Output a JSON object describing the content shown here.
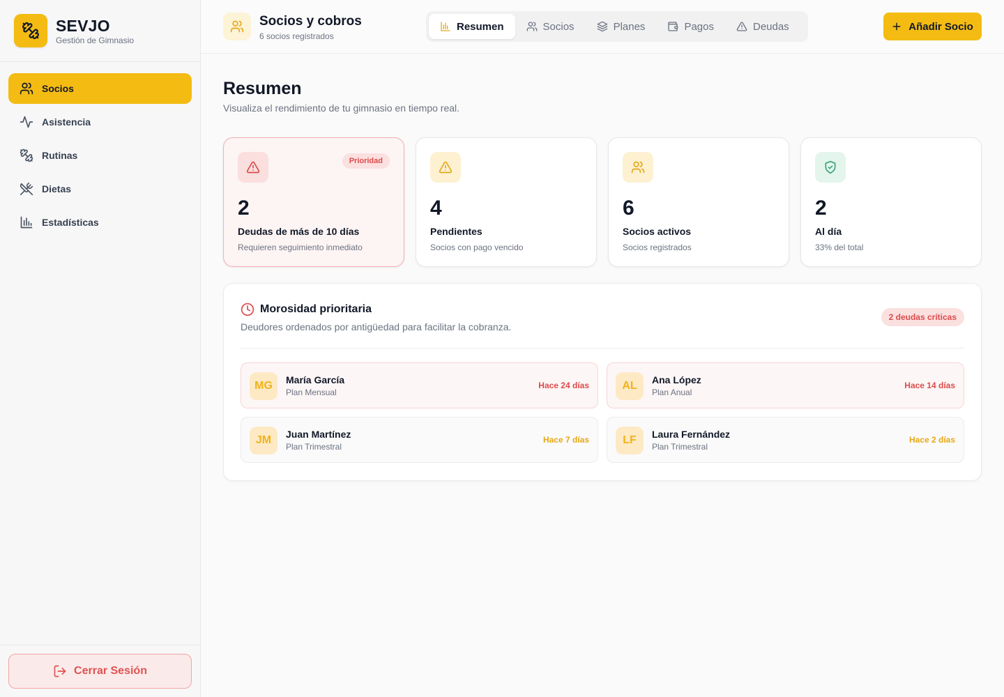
{
  "colors": {
    "accent": "#f4bb13",
    "danger": "#dc4b4b",
    "warning": "#e6a817",
    "success": "#3aa57a"
  },
  "brand": {
    "name": "SEVJO",
    "subtitle": "Gestión de Gimnasio",
    "icon": "dumbbell-icon"
  },
  "sidebar": {
    "items": [
      {
        "label": "Socios",
        "icon": "users-icon",
        "active": true
      },
      {
        "label": "Asistencia",
        "icon": "activity-icon",
        "active": false
      },
      {
        "label": "Rutinas",
        "icon": "dumbbell-icon",
        "active": false
      },
      {
        "label": "Dietas",
        "icon": "utensils-crossed-icon",
        "active": false
      },
      {
        "label": "Estadísticas",
        "icon": "bar-chart-icon",
        "active": false
      }
    ],
    "logout_label": "Cerrar Sesión"
  },
  "header": {
    "title": "Socios y cobros",
    "subtitle": "6 socios registrados",
    "tabs": [
      {
        "label": "Resumen",
        "icon": "chart-icon",
        "active": true
      },
      {
        "label": "Socios",
        "icon": "users-icon",
        "active": false
      },
      {
        "label": "Planes",
        "icon": "layers-icon",
        "active": false
      },
      {
        "label": "Pagos",
        "icon": "wallet-icon",
        "active": false
      },
      {
        "label": "Deudas",
        "icon": "alert-triangle-icon",
        "active": false
      }
    ],
    "add_button_label": "Añadir Socio"
  },
  "main": {
    "title": "Resumen",
    "subtitle": "Visualiza el rendimiento de tu gimnasio en tiempo real."
  },
  "stats": [
    {
      "value": "2",
      "label": "Deudas de más de 10 días",
      "description": "Requieren seguimiento inmediato",
      "badge": "Prioridad",
      "icon": "alert-triangle-icon"
    },
    {
      "value": "4",
      "label": "Pendientes",
      "description": "Socios con pago vencido",
      "icon": "alert-triangle-icon"
    },
    {
      "value": "6",
      "label": "Socios activos",
      "description": "Socios registrados",
      "icon": "users-icon"
    },
    {
      "value": "2",
      "label": "Al día",
      "description": "33% del total",
      "icon": "shield-check-icon"
    }
  ],
  "morosidad": {
    "title": "Morosidad prioritaria",
    "subtitle": "Deudores ordenados por antigüedad para facilitar la cobranza.",
    "badge": "2 deudas críticas",
    "debtors": [
      {
        "initials": "MG",
        "name": "María García",
        "plan": "Plan Mensual",
        "age": "Hace 24 días",
        "critical": true
      },
      {
        "initials": "AL",
        "name": "Ana López",
        "plan": "Plan Anual",
        "age": "Hace 14 días",
        "critical": true
      },
      {
        "initials": "JM",
        "name": "Juan Martínez",
        "plan": "Plan Trimestral",
        "age": "Hace 7 días",
        "critical": false
      },
      {
        "initials": "LF",
        "name": "Laura Fernández",
        "plan": "Plan Trimestral",
        "age": "Hace 2 días",
        "critical": false
      }
    ]
  }
}
